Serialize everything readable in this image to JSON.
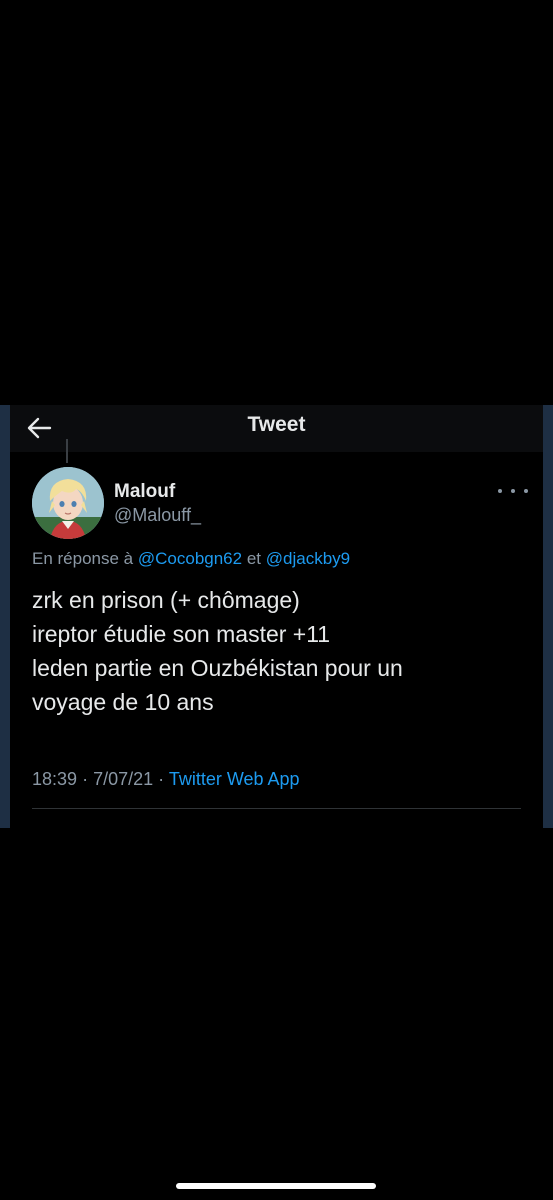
{
  "header": {
    "title": "Tweet",
    "back_icon": "arrow-left-icon"
  },
  "author": {
    "name": "Malouf",
    "handle": "@Malouff_",
    "avatar": "anime-avatar"
  },
  "reply": {
    "prefix": "En réponse à",
    "mention_1": "@Cocobgn62",
    "connector": "et",
    "mention_2": "@djackby9"
  },
  "tweet": {
    "lines": [
      "zrk en prison (+ chômage)",
      "ireptor étudie son master +11",
      "leden partie en Ouzbékistan pour un",
      "voyage de 10 ans"
    ]
  },
  "meta": {
    "time": "18:39",
    "separator": "·",
    "date": "7/07/21",
    "source": "Twitter Web App"
  },
  "colors": {
    "background": "#000000",
    "text": "#e7e9ea",
    "secondary": "#8b98a5",
    "accent": "#1d9bf0",
    "frame": "#1e2f44"
  }
}
